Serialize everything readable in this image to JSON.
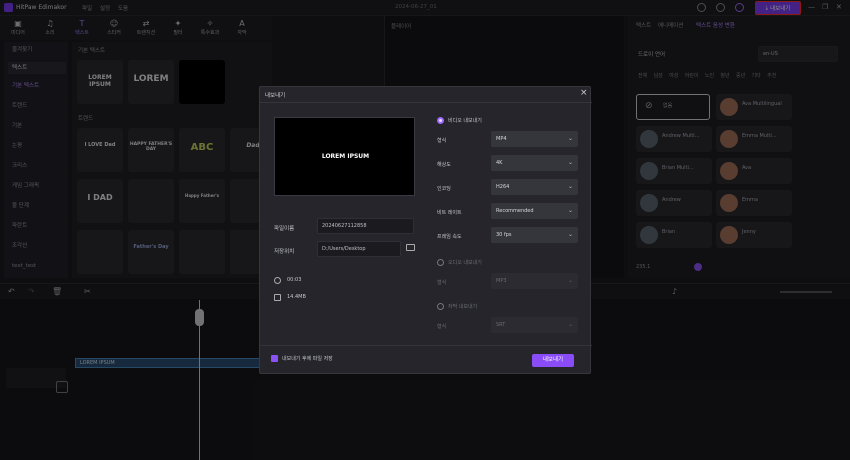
{
  "titlebar": {
    "app_name": "HitPaw Edimakor",
    "menus": [
      "파일",
      "설정",
      "도움"
    ],
    "project_name": "2024-06-27_01",
    "export_label": "내보내기",
    "accent_color": "#7b3df2",
    "highlight_color": "#ff2a2a"
  },
  "tooltabs": [
    {
      "label": "미디어",
      "icon": "media-icon"
    },
    {
      "label": "소리",
      "icon": "audio-icon"
    },
    {
      "label": "텍스트",
      "icon": "text-icon"
    },
    {
      "label": "스티커",
      "icon": "sticker-icon"
    },
    {
      "label": "트랜지션",
      "icon": "transition-icon"
    },
    {
      "label": "필터",
      "icon": "filter-icon"
    },
    {
      "label": "특수효과",
      "icon": "effect-icon"
    },
    {
      "label": "자막",
      "icon": "subtitle-icon"
    }
  ],
  "leftnav": {
    "items": [
      "즐겨찾기",
      "텍스트",
      "기본 텍스트",
      "트렌드",
      "기본",
      "논평",
      "크리스",
      "게임 그래픽",
      "불 단계",
      "파란트",
      "조각선",
      "text_test"
    ],
    "selected_index": 1,
    "active_index": 2
  },
  "grid": {
    "section_basic": "기본 텍스트",
    "section_trend": "트렌드",
    "basic_thumbs": [
      "LOREM IPSUM",
      "LOREM",
      ""
    ],
    "trend_thumbs": [
      "I LOVE Dad",
      "HAPPY FATHER'S DAY",
      "ABC",
      "Dad",
      "I DAD",
      "",
      "Happy Father's",
      "",
      "",
      "Father's Day",
      "",
      ""
    ]
  },
  "preview": {
    "title": "플레이어"
  },
  "rightpanel": {
    "tabs": [
      "텍스트",
      "애니메이션",
      "텍스트 음성 변환"
    ],
    "language_label": "드로이 언어",
    "language_value": "en-US",
    "filters": [
      "전체",
      "남성",
      "여성",
      "어린이",
      "노인",
      "청년",
      "중년",
      "기타",
      "추천"
    ],
    "none_label": "없음",
    "voices": [
      "Ava Multilingual",
      "Andrew Multi...",
      "Emma Multi...",
      "Brian Multi...",
      "Ava",
      "Andrew",
      "Emma",
      "Brian",
      "Jenny"
    ],
    "duration_readout": "235.1"
  },
  "modal": {
    "title": "내보내기",
    "preview_text": "LOREM IPSUM",
    "filename_label": "파일이름",
    "filename_value": "20240627112858",
    "save_to_label": "저장위치",
    "save_to_value": "D:/Users/Desktop",
    "duration": "00:03",
    "file_size": "14.4MB",
    "video_section_label": "비디오 내보내기",
    "format_label": "형식",
    "format_value": "MP4",
    "resolution_label": "해상도",
    "resolution_value": "4K",
    "encoder_label": "인코딩",
    "encoder_value": "H264",
    "bitrate_label": "비트 레이트",
    "bitrate_value": "Recommended",
    "framerate_label": "프레임 속도",
    "framerate_value": "30 fps",
    "audio_section_label": "오디오 내보내기",
    "audio_format_value": "MP3",
    "subtitle_section_label": "자막 내보내기",
    "subtitle_format_label": "형식",
    "subtitle_format_value": "SRT",
    "checkbox_label": "내보내기 후에 파일 저장",
    "confirm_label": "내보내기"
  },
  "timeline": {
    "clip_label": "LOREM IPSUM"
  }
}
